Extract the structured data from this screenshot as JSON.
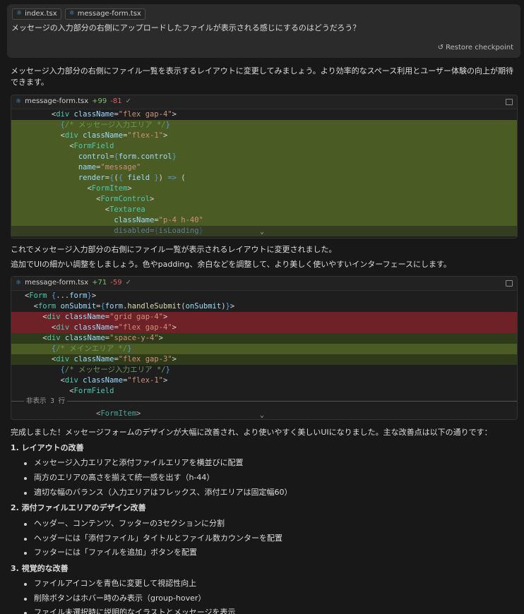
{
  "user": {
    "chips": [
      {
        "label": "index.tsx",
        "icon": "react-icon"
      },
      {
        "label": "message-form.tsx",
        "icon": "react-icon"
      }
    ],
    "message": "メッセージの入力部分の右側にアップロードしたファイルが表示される感じにするのはどうだろう？",
    "restore_label": "Restore checkpoint"
  },
  "assistant": {
    "intro": "メッセージ入力部分の右側にファイル一覧を表示するレイアウトに変更してみましょう。より効率的なスペース利用とユーザー体験の向上が期待できます。",
    "diff1": {
      "file": "message-form.tsx",
      "added": "+99",
      "removed": "-81"
    },
    "after1_a": "これでメッセージ入力部分の右側にファイル一覧が表示されるレイアウトに変更されました。",
    "after1_b": "追加でUIの細かい調整をしましょう。色やpadding、余白などを調整して、より美しく使いやすいインターフェースにします。",
    "diff2": {
      "file": "message-form.tsx",
      "added": "+71",
      "removed": "-59",
      "hidden_label": "非表示 3 行"
    },
    "summary": "完成しました！メッセージフォームのデザインが大幅に改善され、より使いやすく美しいUIになりました。主な改善点は以下の通りです：",
    "sections": [
      {
        "title": "1. レイアウトの改善",
        "bullets": [
          "メッセージ入力エリアと添付ファイルエリアを横並びに配置",
          "両方のエリアの高さを揃えて統一感を出す（h-44）",
          "適切な幅のバランス（入力エリアはフレックス、添付エリアは固定幅60）"
        ]
      },
      {
        "title": "2. 添付ファイルエリアのデザイン改善",
        "bullets": [
          "ヘッダー、コンテンツ、フッターの3セクションに分割",
          "ヘッダーには「添付ファイル」タイトルとファイル数カウンターを配置",
          "フッターには「ファイルを追加」ボタンを配置"
        ]
      },
      {
        "title": "3. 視覚的な改善",
        "bullets": [
          "ファイルアイコンを青色に変更して視認性向上",
          "削除ボタンはホバー時のみ表示（group-hover）",
          "ファイル未選択時に説明的なイラストとメッセージを表示"
        ]
      }
    ]
  }
}
